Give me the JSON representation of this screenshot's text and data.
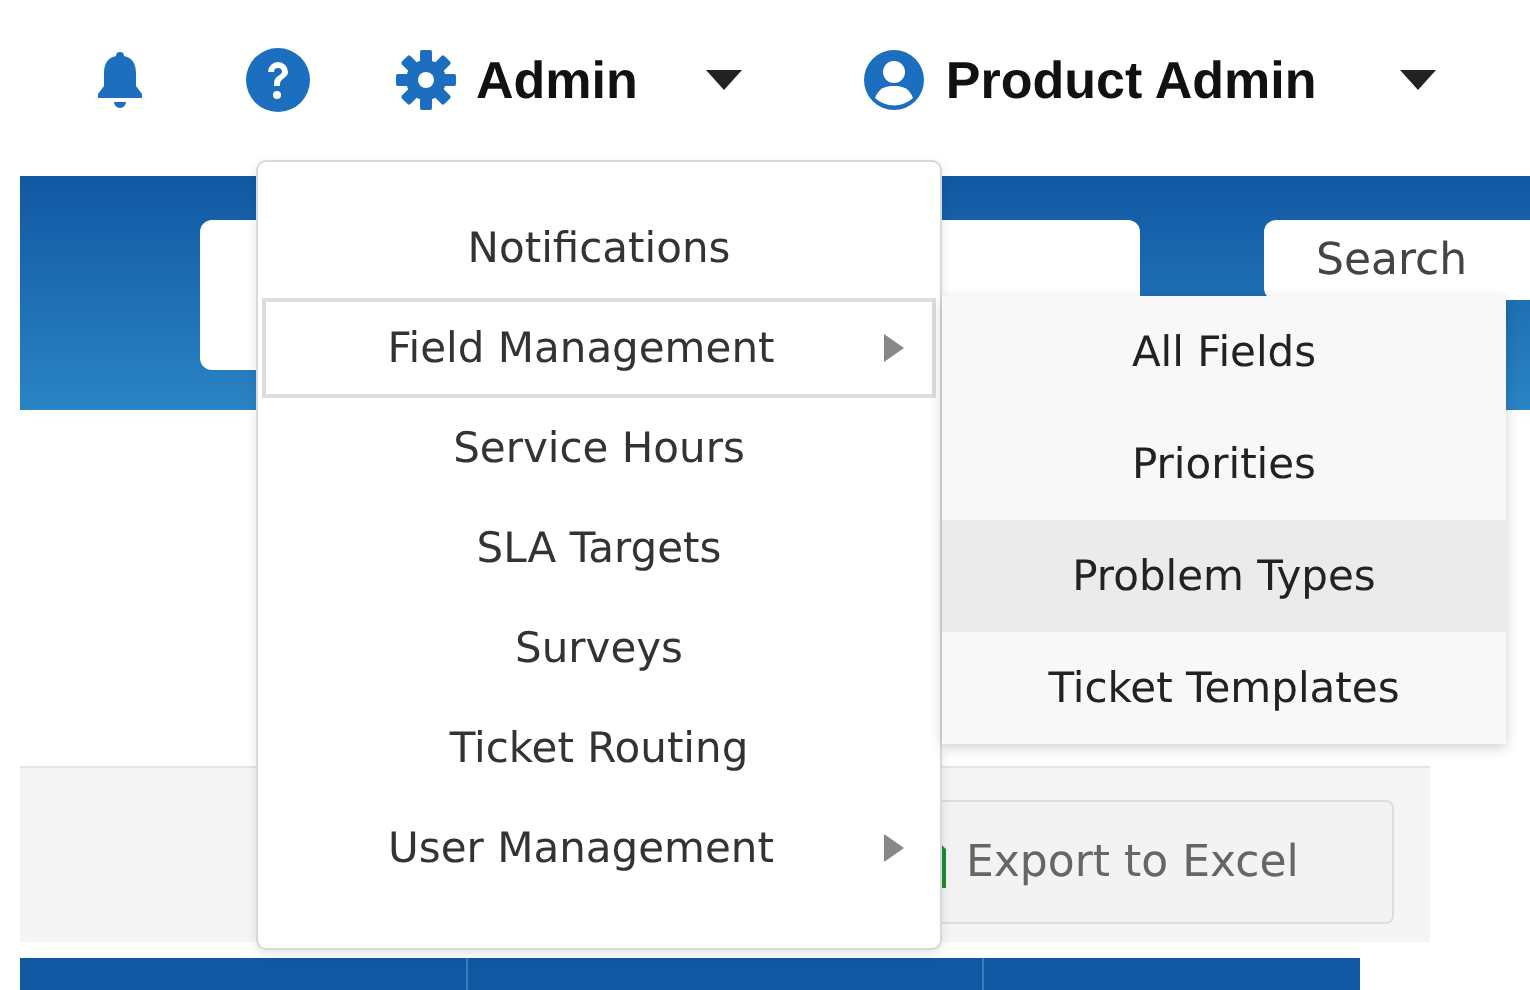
{
  "nav": {
    "admin": {
      "label": "Admin"
    },
    "user": {
      "label": "Product Admin"
    }
  },
  "search": {
    "placeholder": "Search"
  },
  "admin_menu": {
    "items": [
      {
        "label": "Notifications",
        "submenu": false,
        "selected": false
      },
      {
        "label": "Field Management",
        "submenu": true,
        "selected": true
      },
      {
        "label": "Service Hours",
        "submenu": false,
        "selected": false
      },
      {
        "label": "SLA Targets",
        "submenu": false,
        "selected": false
      },
      {
        "label": "Surveys",
        "submenu": false,
        "selected": false
      },
      {
        "label": "Ticket Routing",
        "submenu": false,
        "selected": false
      },
      {
        "label": "User Management",
        "submenu": true,
        "selected": false
      }
    ]
  },
  "field_submenu": {
    "items": [
      {
        "label": "All Fields",
        "selected": false
      },
      {
        "label": "Priorities",
        "selected": false
      },
      {
        "label": "Problem Types",
        "selected": true
      },
      {
        "label": "Ticket Templates",
        "selected": false
      }
    ]
  },
  "toolbar": {
    "export_button": {
      "label": "Export to Excel"
    }
  }
}
